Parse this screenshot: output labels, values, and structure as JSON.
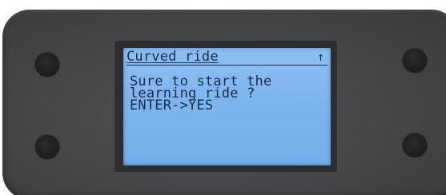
{
  "display": {
    "title": "Curved ride",
    "indicator": "↑",
    "lines": [
      "Sure to start the",
      "learning ride ?",
      "ENTER->YES"
    ]
  },
  "colors": {
    "housing": "#454446",
    "lcd_background": "#7db5ee",
    "lcd_text": "#1b2a4a",
    "button": "#1d1c1e"
  },
  "icons": {
    "indicator": "arrow-up-icon"
  }
}
